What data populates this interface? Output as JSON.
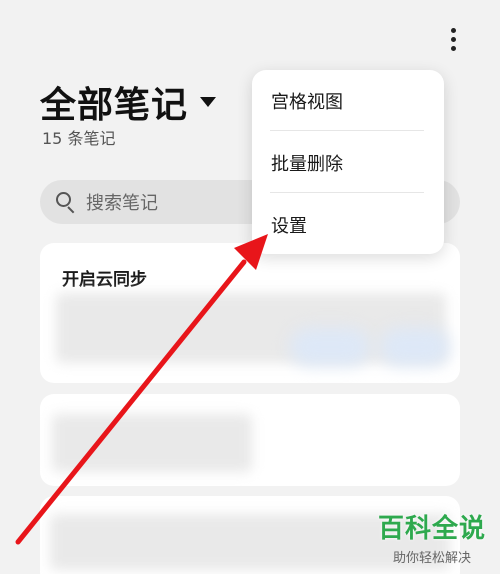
{
  "header": {
    "title": "全部笔记",
    "note_count": "15 条笔记"
  },
  "search": {
    "placeholder": "搜索笔记"
  },
  "notes": [
    {
      "title": "开启云同步"
    }
  ],
  "menu": {
    "items": [
      {
        "label": "宫格视图"
      },
      {
        "label": "批量删除"
      },
      {
        "label": "设置"
      }
    ]
  },
  "annotation": {
    "arrow_color": "#e8151a"
  },
  "watermark": {
    "title": "百科全说",
    "subtitle": "助你轻松解决",
    "color": "#2ea94e"
  },
  "icons": {
    "more": "more-vertical-icon",
    "dropdown": "caret-down-icon",
    "search": "search-icon"
  }
}
